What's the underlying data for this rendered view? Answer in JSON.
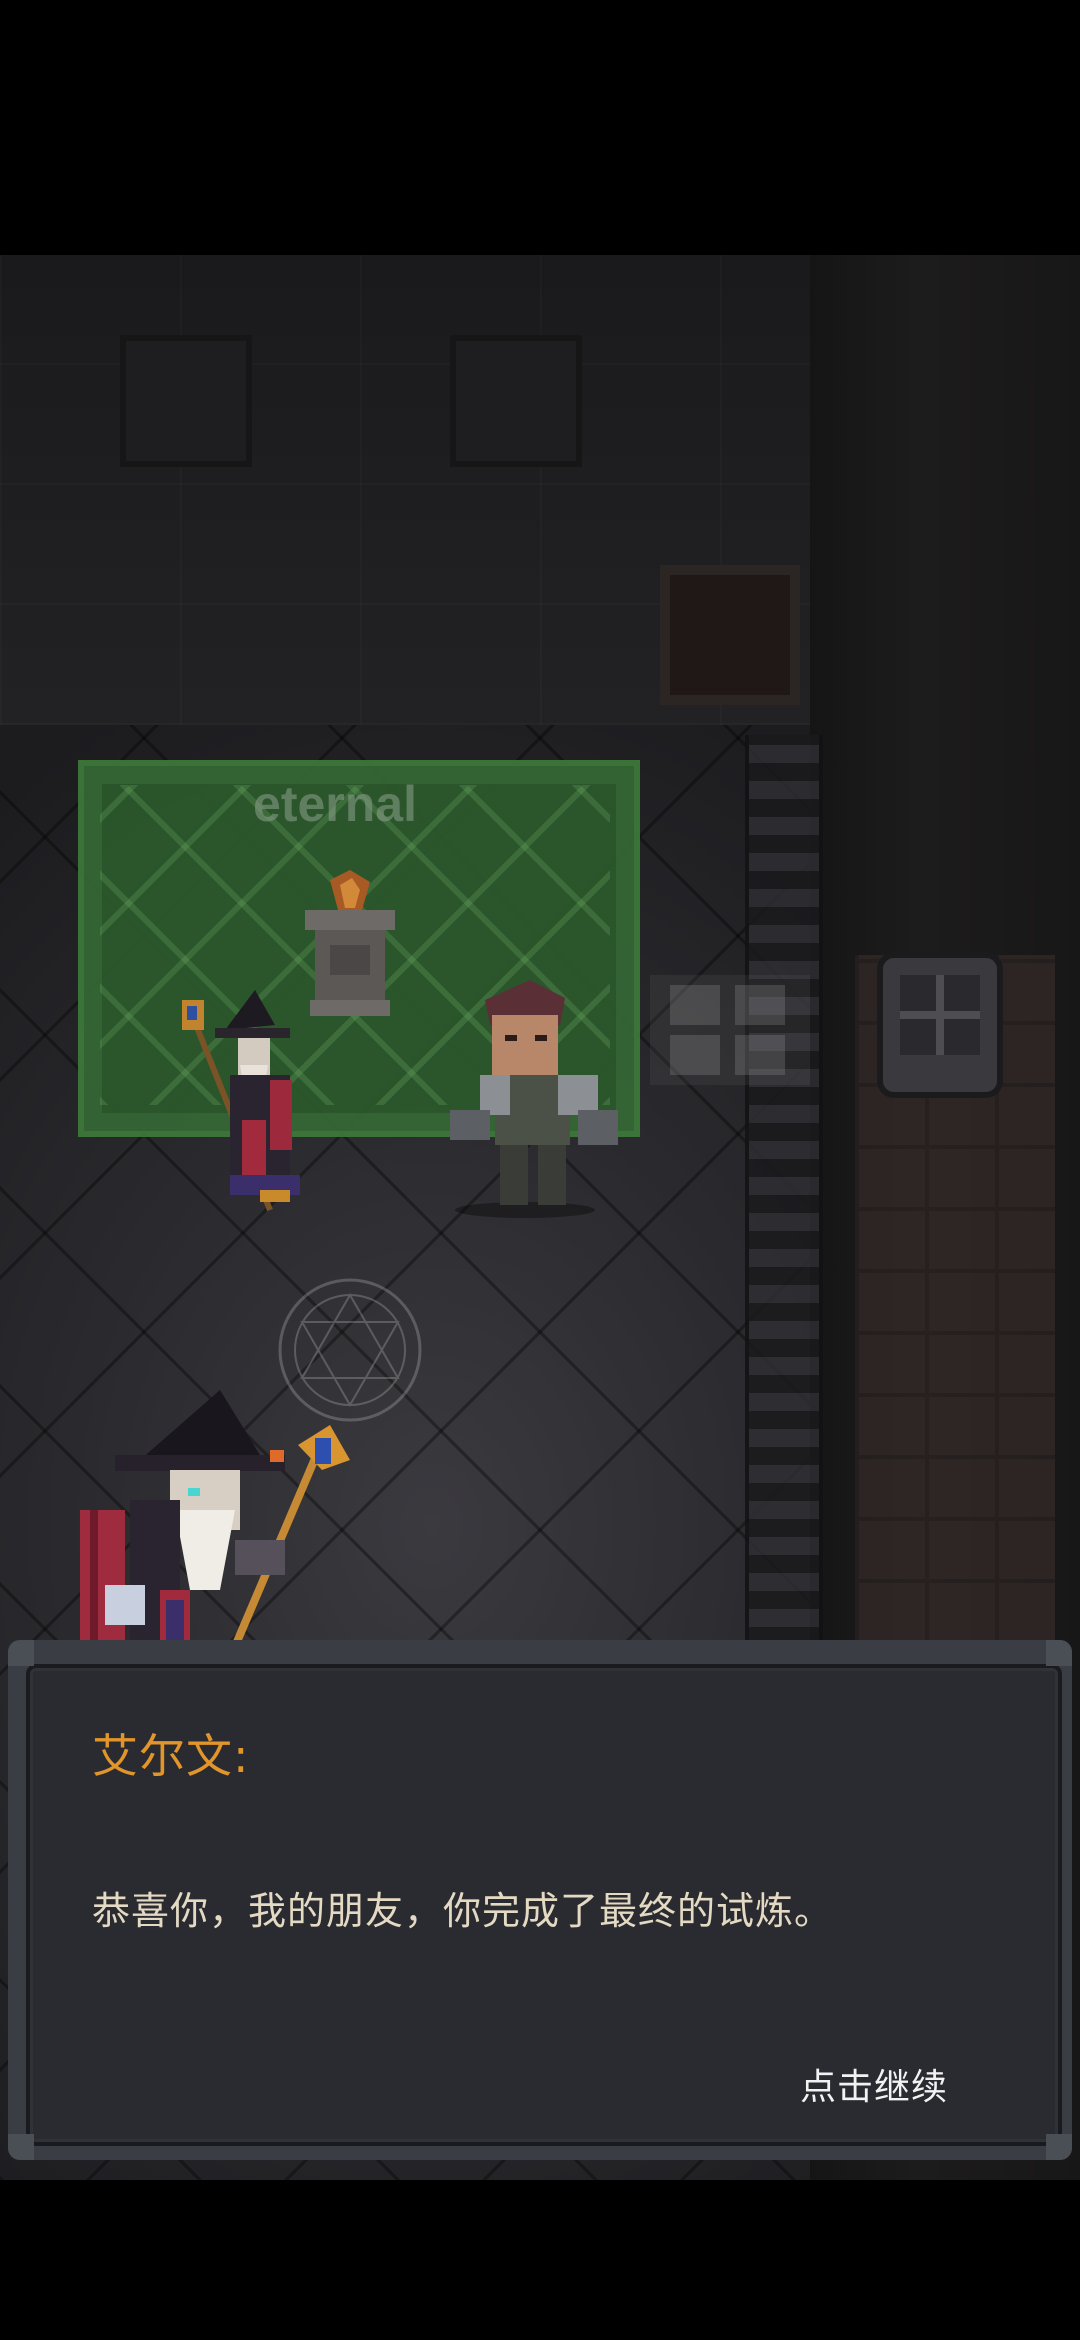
{
  "scene": {
    "rug_label": "eternal"
  },
  "dialog": {
    "speaker": "艾尔文:",
    "message": "恭喜你，我的朋友，你完成了最终的试炼。",
    "continue_label": "点击继续"
  },
  "colors": {
    "speaker": "#e2952a",
    "message": "#e4d9c3",
    "dialog_bg": "#2a2b31",
    "rug": "#2c5a2c"
  },
  "icons": [
    "wizard-sprite",
    "hero-sprite",
    "wizard-portrait",
    "torch-pedestal",
    "lantern-icon",
    "magic-circle-icon"
  ]
}
